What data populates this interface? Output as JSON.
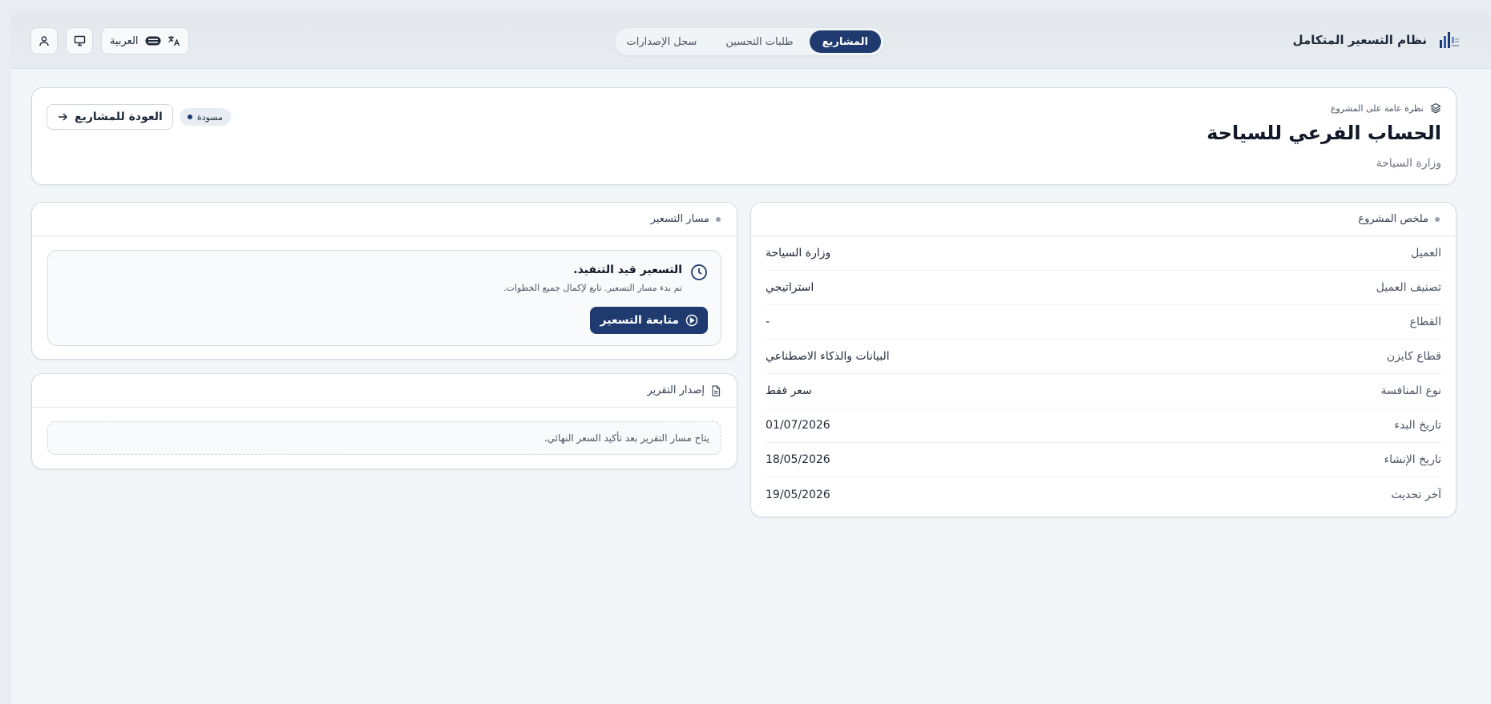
{
  "app": {
    "title": "نظام التسعير المتكامل"
  },
  "nav": {
    "items": [
      {
        "label": "المشاريع",
        "active": true
      },
      {
        "label": "طلبات التحسين",
        "active": false
      },
      {
        "label": "سجل الإصدارات",
        "active": false
      }
    ]
  },
  "tools": {
    "language_label": "العربية"
  },
  "overview": {
    "kicker": "نظرة عامة على المشروع",
    "title": "الحساب الفرعي للسياحة",
    "subtitle": "وزارة السياحة",
    "status_badge": "مسودة",
    "back_label": "العودة للمشاريع"
  },
  "summary": {
    "heading": "ملخص المشروع",
    "rows": [
      {
        "label": "العميل",
        "value": "وزارة السياحة"
      },
      {
        "label": "تصنيف العميل",
        "value": "استراتيجي"
      },
      {
        "label": "القطاع",
        "value": "-"
      },
      {
        "label": "قطاع كايزن",
        "value": "البيانات والذكاء الاصطناعي"
      },
      {
        "label": "نوع المنافسة",
        "value": "سعر فقط"
      },
      {
        "label": "تاريخ البدء",
        "value": "01/07/2026"
      },
      {
        "label": "تاريخ الإنشاء",
        "value": "18/05/2026"
      },
      {
        "label": "آخر تحديث",
        "value": "19/05/2026"
      }
    ]
  },
  "pricing": {
    "heading": "مسار التسعير",
    "status_title": "التسعير قيد التنفيذ.",
    "status_desc": "تم بدء مسار التسعير. تابع لإكمال جميع الخطوات.",
    "follow_label": "متابعة التسعير"
  },
  "report": {
    "heading": "إصدار التقرير",
    "note": "يتاح مسار التقرير بعد تأكيد السعر النهائي."
  },
  "colors": {
    "primary": "#1e3a6e",
    "background": "#f3f6f8"
  }
}
